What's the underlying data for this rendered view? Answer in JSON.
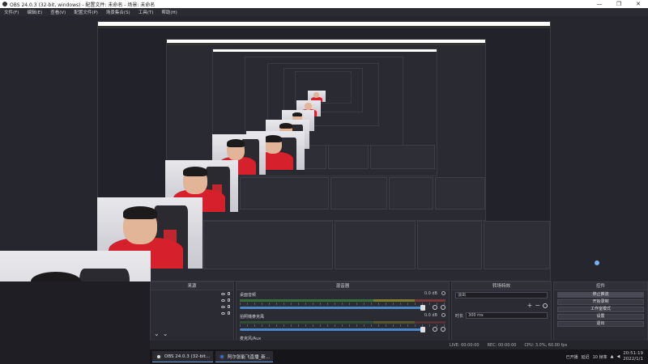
{
  "window": {
    "title": "OBS 24.0.3 (32-bit, windows) - 配置文件: 未命名 - 场景: 未命名",
    "controls": [
      "—",
      "❐",
      "✕"
    ]
  },
  "menu": [
    "文件(F)",
    "编辑(E)",
    "查看(V)",
    "配置文件(P)",
    "场景集合(S)",
    "工具(T)",
    "帮助(H)"
  ],
  "docks": {
    "sources": {
      "title": "来源"
    },
    "mixer": {
      "title": "混音器",
      "channels": [
        {
          "name": "桌面音频",
          "db": "0.0 dB"
        },
        {
          "name": "拍照機麥克風",
          "db": "0.0 dB"
        },
        {
          "name": "麦克风/Aux",
          "db": ""
        }
      ]
    },
    "transitions": {
      "title": "转场特效",
      "selected": "淡出",
      "duration_label": "时长",
      "duration_value": "300 ms"
    },
    "controls": {
      "title": "控件",
      "buttons": [
        "停止推流",
        "开始录制",
        "工作室模式",
        "设置",
        "退出"
      ]
    }
  },
  "status": {
    "live": "LIVE: 00:00:00",
    "rec": "REC: 00:00:00",
    "cpu": "CPU: 3.0%, 60.00 fps"
  },
  "taskbar": {
    "app_label": "阿尔张能飞直播_新...",
    "obs_label": "OBS 24.0.3 (32-bit...",
    "tray_text": "延迟",
    "tray_badge": "10 帧率",
    "tray_note": "已开播",
    "time": "20:51:19",
    "date": "2022/1/1"
  },
  "colors": {
    "accent": "#4b86c8",
    "active_border": "#6aa0e0",
    "shirt_red": "#d6202c"
  }
}
